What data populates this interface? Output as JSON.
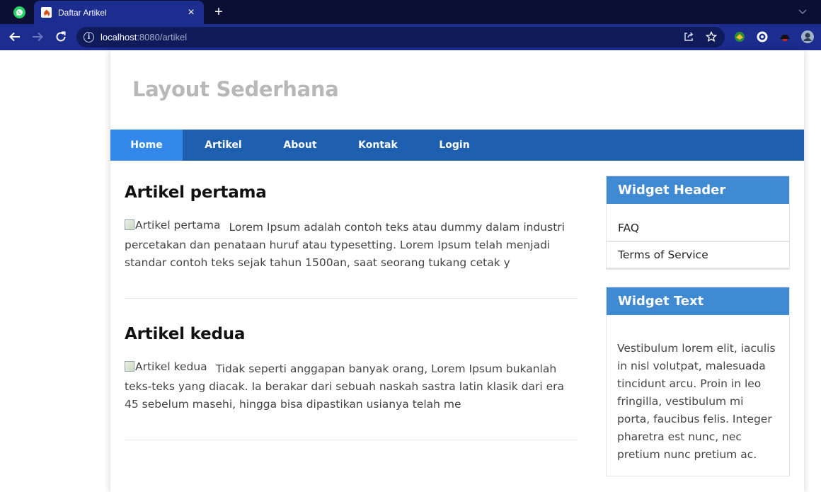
{
  "browser": {
    "tab_title": "Daftar Artikel",
    "new_tab_symbol": "+",
    "close_symbol": "×",
    "url_host": "localhost",
    "url_rest": ":8080/artikel",
    "colors": {
      "tabbar": "#0b0f33",
      "toolbar": "#1c2c8f",
      "omnibox": "#0f1b5a"
    },
    "icons": [
      "whatsapp-icon",
      "codeigniter-icon",
      "back-arrow-icon",
      "forward-arrow-icon",
      "reload-icon",
      "info-icon",
      "share-icon",
      "star-icon",
      "extension-icon",
      "profile-avatar-icon"
    ]
  },
  "site": {
    "title": "Layout Sederhana",
    "nav": [
      {
        "label": "Home",
        "active": true
      },
      {
        "label": "Artikel",
        "active": false
      },
      {
        "label": "About",
        "active": false
      },
      {
        "label": "Kontak",
        "active": false
      },
      {
        "label": "Login",
        "active": false
      }
    ],
    "colors": {
      "navbar": "#1f5fb0",
      "nav_active": "#3389ea",
      "widget_header": "#3f8ad2",
      "title": "#b8b8b8"
    }
  },
  "articles": [
    {
      "title": "Artikel pertama",
      "img_alt": "Artikel pertama",
      "body": "Lorem Ipsum adalah contoh teks atau dummy dalam industri percetakan dan penataan huruf atau typesetting. Lorem Ipsum telah menjadi standar contoh teks sejak tahun 1500an, saat seorang tukang cetak y"
    },
    {
      "title": "Artikel kedua",
      "img_alt": "Artikel kedua",
      "body": "Tidak seperti anggapan banyak orang, Lorem Ipsum bukanlah teks-teks yang diacak. Ia berakar dari sebuah naskah sastra latin klasik dari era 45 sebelum masehi, hingga bisa dipastikan usianya telah me"
    }
  ],
  "sidebar": {
    "widget_header": {
      "title": "Widget Header",
      "links": [
        "FAQ",
        "Terms of Service"
      ]
    },
    "widget_text": {
      "title": "Widget Text",
      "body": "Vestibulum lorem elit, iaculis in nisl volutpat, malesuada tincidunt arcu. Proin in leo fringilla, vestibulum mi porta, faucibus felis. Integer pharetra est nunc, nec pretium nunc pretium ac."
    }
  }
}
